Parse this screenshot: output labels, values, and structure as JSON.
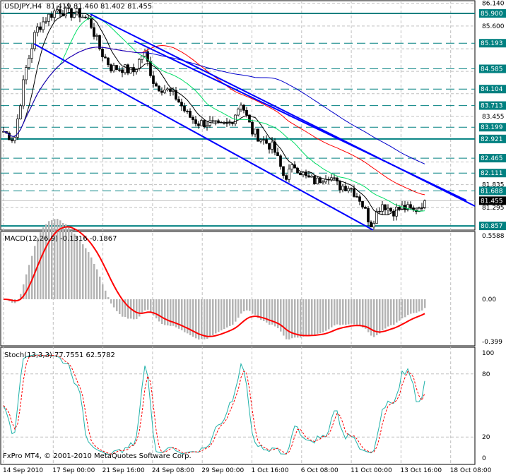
{
  "header": {
    "symbol": "USDJPY,H4",
    "ohlc": "81.419 81.460 81.402 81.455"
  },
  "macd": {
    "label": "MACD(12,26,9) -0.1316 -0.1867",
    "axis": [
      "0.5588",
      "0.00",
      "-0.399"
    ],
    "range": [
      -0.399,
      0.5588
    ]
  },
  "stoch": {
    "label": "Stoch(13,3,3) 77.7551 62.5782",
    "axis": [
      "100",
      "80",
      "20",
      "0"
    ]
  },
  "copyright": "FxPro MT4, © 2001-2010 MetaQuotes Software Corp.",
  "time_axis": [
    "14 Sep 2010",
    "17 Sep 00:00",
    "21 Sep 16:00",
    "24 Sep 08:00",
    "29 Sep 00:00",
    "1 Oct 16:00",
    "6 Oct 08:00",
    "11 Oct 00:00",
    "13 Oct 16:00",
    "18 Oct 08:00"
  ],
  "price_axis": [
    "86.140",
    "85.600",
    "83.455",
    "81.835",
    "81.295"
  ],
  "levels": [
    {
      "label": "85.900",
      "value": 85.9,
      "style": "solid"
    },
    {
      "label": "85.193",
      "value": 85.193,
      "style": "dashed"
    },
    {
      "label": "84.585",
      "value": 84.585,
      "style": "dashed"
    },
    {
      "label": "84.104",
      "value": 84.104,
      "style": "dashed"
    },
    {
      "label": "83.713",
      "value": 83.713,
      "style": "dashed"
    },
    {
      "label": "83.199",
      "value": 83.199,
      "style": "dashed"
    },
    {
      "label": "82.921",
      "value": 82.921,
      "style": "solid"
    },
    {
      "label": "82.465",
      "value": 82.465,
      "style": "dashed"
    },
    {
      "label": "82.111",
      "value": 82.111,
      "style": "dashed"
    },
    {
      "label": "81.688",
      "value": 81.688,
      "style": "dashed"
    },
    {
      "label": "80.857",
      "value": 80.857,
      "style": "solid"
    }
  ],
  "current_price": {
    "label": "81.455",
    "value": 81.455
  },
  "colors": {
    "level": "#008080",
    "channel": "#0000ff",
    "ma_red": "#ff0000",
    "ma_blue": "#0000cc",
    "ma_green": "#00dd66",
    "macd_signal": "#ff0000",
    "hist": "#b4b4b4",
    "stoch_main": "#20b2aa",
    "stoch_signal": "#ff0000"
  },
  "chart_data": {
    "type": "candlestick",
    "anchor_closes": [
      83.1,
      82.9,
      84.5,
      85.5,
      85.8,
      86.0,
      85.9,
      85.9,
      85.7,
      85.0,
      84.6,
      84.6,
      84.5,
      85.0,
      84.2,
      84.1,
      83.9,
      83.5,
      83.3,
      83.3,
      83.2,
      83.3,
      83.8,
      83.1,
      82.9,
      82.7,
      82.0,
      82.3,
      82.0,
      81.9,
      82.1,
      81.8,
      81.8,
      81.5,
      80.9,
      81.4,
      81.2,
      81.3,
      81.2,
      81.455
    ],
    "ylim": [
      80.77,
      86.14
    ]
  }
}
